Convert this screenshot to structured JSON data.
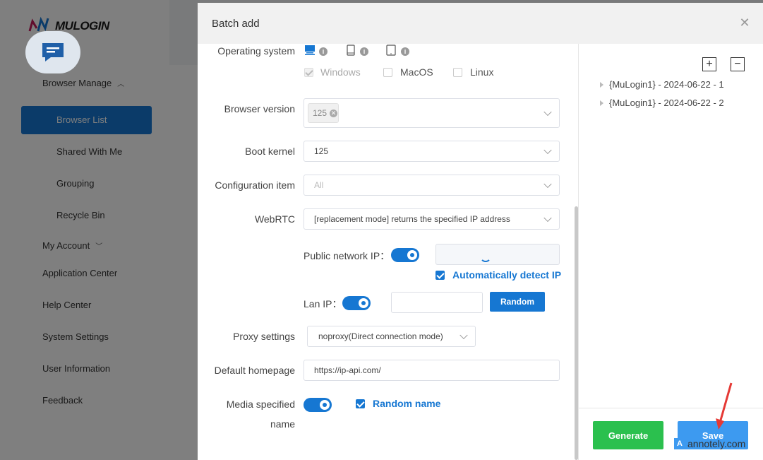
{
  "app": {
    "logo_text": "MULOGIN",
    "nav": {
      "browser_manage": "Browser Manage",
      "browser_list": "Browser List",
      "shared_with_me": "Shared With Me",
      "grouping": "Grouping",
      "recycle_bin": "Recycle Bin",
      "my_account": "My Account",
      "application_center": "Application Center",
      "help_center": "Help Center",
      "system_settings": "System Settings",
      "user_information": "User Information",
      "feedback": "Feedback"
    }
  },
  "modal": {
    "title": "Batch add",
    "close_icon": "close-icon",
    "form": {
      "operating_system": {
        "label": "Operating system",
        "icons": [
          "desktop-icon",
          "mobile-icon",
          "tablet-icon"
        ],
        "options": [
          {
            "label": "Windows",
            "checked": true,
            "disabled": true
          },
          {
            "label": "MacOS",
            "checked": false
          },
          {
            "label": "Linux",
            "checked": false
          }
        ]
      },
      "browser_version": {
        "label": "Browser version",
        "tag": "125"
      },
      "boot_kernel": {
        "label": "Boot kernel",
        "value": "125"
      },
      "configuration_item": {
        "label": "Configuration item",
        "value": "All"
      },
      "webrtc": {
        "label": "WebRTC",
        "value": "[replacement mode] returns the specified IP address"
      },
      "public_network_ip": {
        "label": "Public network IP：",
        "enabled": true,
        "value": "",
        "auto_detect_label": "Automatically detect IP",
        "auto_detect": true
      },
      "lan_ip": {
        "label": "Lan IP：",
        "enabled": true,
        "value": "",
        "random_button": "Random"
      },
      "proxy_settings": {
        "label": "Proxy settings",
        "value": "noproxy(Direct connection mode)"
      },
      "default_homepage": {
        "label": "Default homepage",
        "value": "https://ip-api.com/"
      },
      "media_specified_name": {
        "label_line1": "Media specified",
        "label_line2": "name",
        "enabled": true,
        "random_name_label": "Random name",
        "random_name": true
      }
    },
    "tree": {
      "expand_label": "+",
      "collapse_label": "−",
      "items": [
        "{MuLogin1} - 2024-06-22 - 1",
        "{MuLogin1} - 2024-06-22 - 2"
      ]
    },
    "buttons": {
      "generate": "Generate",
      "save": "Save"
    }
  },
  "watermark": {
    "text": "annotely.com",
    "badge": "A"
  },
  "colors": {
    "primary": "#1677d2",
    "generate": "#2bc04e",
    "save": "#3d9af0"
  }
}
